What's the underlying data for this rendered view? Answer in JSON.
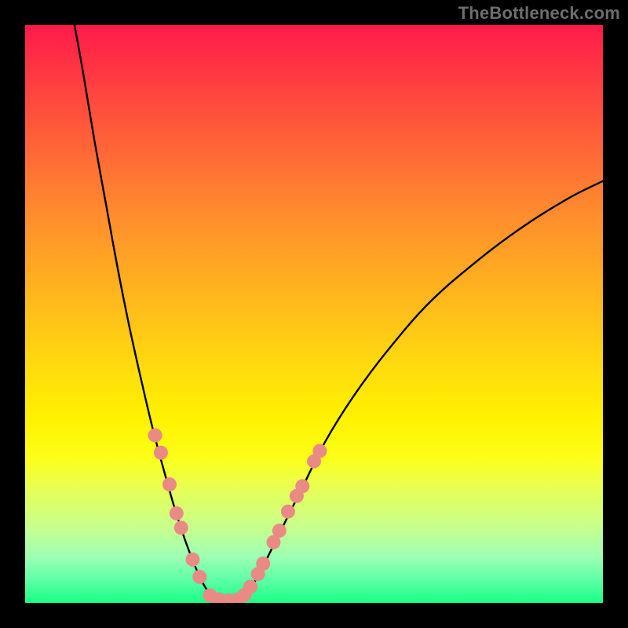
{
  "branding": {
    "text": "TheBottleneck.com"
  },
  "chart_data": {
    "type": "line",
    "title": "",
    "xlabel": "",
    "ylabel": "",
    "xlim": [
      0,
      100
    ],
    "ylim": [
      0,
      100
    ],
    "series": [
      {
        "name": "left-curve",
        "color": "#000000",
        "x": [
          8,
          10,
          12,
          14,
          16,
          18,
          20,
          22,
          24,
          26,
          28,
          30,
          31.5,
          33
        ],
        "y": [
          103,
          92,
          80,
          69,
          58,
          48,
          39,
          30.5,
          23,
          16,
          10,
          5,
          2.2,
          0.5
        ]
      },
      {
        "name": "valley-floor",
        "color": "#000000",
        "x": [
          33,
          34,
          35,
          36,
          37
        ],
        "y": [
          0.5,
          0.3,
          0.3,
          0.3,
          0.5
        ]
      },
      {
        "name": "right-curve",
        "color": "#000000",
        "x": [
          37,
          39,
          41,
          44,
          48,
          52,
          57,
          63,
          70,
          78,
          86,
          94,
          100
        ],
        "y": [
          0.5,
          2.5,
          6,
          12,
          20,
          28,
          36,
          44,
          52,
          59,
          65,
          70,
          73
        ]
      }
    ],
    "markers": {
      "name": "data-points",
      "color": "#e98a84",
      "radius_px": 9,
      "points": [
        {
          "x": 22.5,
          "y": 29
        },
        {
          "x": 23.5,
          "y": 26
        },
        {
          "x": 25.0,
          "y": 20.5
        },
        {
          "x": 26.2,
          "y": 15.5
        },
        {
          "x": 27.0,
          "y": 13
        },
        {
          "x": 29.0,
          "y": 7.5
        },
        {
          "x": 30.2,
          "y": 4.5
        },
        {
          "x": 32.0,
          "y": 1.3
        },
        {
          "x": 33.5,
          "y": 0.6
        },
        {
          "x": 35.2,
          "y": 0.4
        },
        {
          "x": 36.8,
          "y": 0.6
        },
        {
          "x": 38.0,
          "y": 1.4
        },
        {
          "x": 39.0,
          "y": 2.8
        },
        {
          "x": 40.3,
          "y": 5.0
        },
        {
          "x": 41.2,
          "y": 6.8
        },
        {
          "x": 43.0,
          "y": 10.5
        },
        {
          "x": 44.0,
          "y": 12.5
        },
        {
          "x": 45.5,
          "y": 15.8
        },
        {
          "x": 47.0,
          "y": 18.5
        },
        {
          "x": 48.0,
          "y": 20.2
        },
        {
          "x": 50.0,
          "y": 24.5
        },
        {
          "x": 51.0,
          "y": 26.3
        }
      ]
    }
  }
}
